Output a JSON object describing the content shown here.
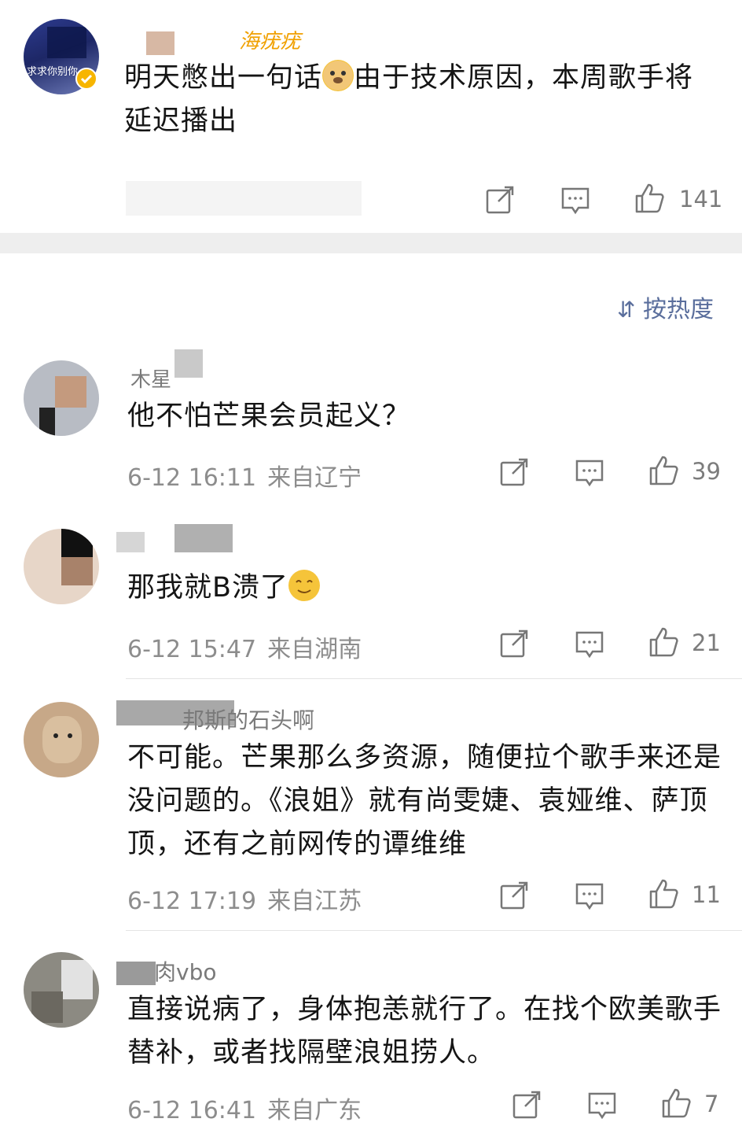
{
  "post": {
    "username_partial": "海疣疣",
    "avatar_text": "求求你别你",
    "text_before_emoji": "明天憋出一句话",
    "text_after_emoji": "由于技术原因，本周歌手将延迟播出",
    "likes": "141"
  },
  "sort_label": "按热度",
  "comments": [
    {
      "username_partial": "木星",
      "text": "他不怕芒果会员起义？",
      "date": "6-12 16:11",
      "location": "来自辽宁",
      "likes": "39"
    },
    {
      "username_partial": "",
      "text": "那我就B溃了",
      "date": "6-12 15:47",
      "location": "来自湖南",
      "likes": "21"
    },
    {
      "username_partial": "邦斯的石头啊",
      "text": "不可能。芒果那么多资源，随便拉个歌手来还是没问题的。《浪姐》就有尚雯婕、袁娅维、萨顶顶，还有之前网传的谭维维",
      "date": "6-12 17:19",
      "location": "来自江苏",
      "likes": "11"
    },
    {
      "username_partial": "肉vbo",
      "text": "直接说病了，身体抱恙就行了。在找个欧美歌手替补，或者找隔壁浪姐捞人。",
      "date": "6-12 16:41",
      "location": "来自广东",
      "likes": "7"
    }
  ],
  "icons": {
    "share": "share-icon",
    "comment": "comment-icon",
    "like": "thumbs-up-icon",
    "sort": "sort-icon",
    "verified": "verified-badge-icon"
  },
  "colors": {
    "sort_accent": "#5a6e9c",
    "meta_gray": "#8d8d8d",
    "verified_gold": "#f7b500"
  }
}
